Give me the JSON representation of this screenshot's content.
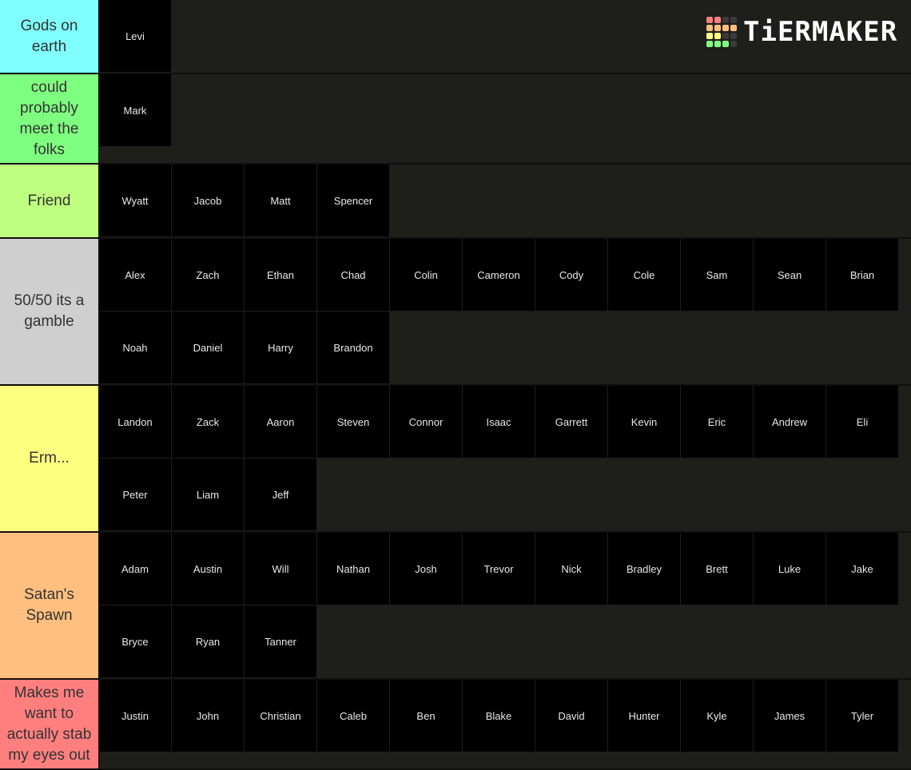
{
  "logo": {
    "text": "TiERMAKER",
    "grid_colors": [
      "#ff7f7f",
      "#ff7f7f",
      "#3a3a3a",
      "#3a3a3a",
      "#ffbf7f",
      "#ffbf7f",
      "#ffbf7f",
      "#ffbf7f",
      "#ffff7f",
      "#ffff7f",
      "#3a3a3a",
      "#3a3a3a",
      "#7fff7f",
      "#7fff7f",
      "#7fff7f",
      "#3a3a3a"
    ]
  },
  "tiers": [
    {
      "label": "Gods on earth",
      "color": "#7fffff",
      "items": [
        "Levi"
      ]
    },
    {
      "label": "could probably meet the folks",
      "color": "#7fff7f",
      "items": [
        "Mark"
      ]
    },
    {
      "label": "Friend",
      "color": "#bfff7f",
      "items": [
        "Wyatt",
        "Jacob",
        "Matt",
        "Spencer"
      ]
    },
    {
      "label": "50/50 its a gamble",
      "color": "#cfcfcf",
      "items": [
        "Alex",
        "Zach",
        "Ethan",
        "Chad",
        "Colin",
        "Cameron",
        "Cody",
        "Cole",
        "Sam",
        "Sean",
        "Brian",
        "Noah",
        "Daniel",
        "Harry",
        "Brandon"
      ]
    },
    {
      "label": "Erm...",
      "color": "#ffff7f",
      "items": [
        "Landon",
        "Zack",
        "Aaron",
        "Steven",
        "Connor",
        "Isaac",
        "Garrett",
        "Kevin",
        "Eric",
        "Andrew",
        "Eli",
        "Peter",
        "Liam",
        "Jeff"
      ]
    },
    {
      "label": "Satan's Spawn",
      "color": "#ffbf7f",
      "items": [
        "Adam",
        "Austin",
        "Will",
        "Nathan",
        "Josh",
        "Trevor",
        "Nick",
        "Bradley",
        "Brett",
        "Luke",
        "Jake",
        "Bryce",
        "Ryan",
        "Tanner"
      ]
    },
    {
      "label": "Makes me want to actually stab my eyes out",
      "color": "#ff7f7f",
      "items": [
        "Justin",
        "John",
        "Christian",
        "Caleb",
        "Ben",
        "Blake",
        "David",
        "Hunter",
        "Kyle",
        "James",
        "Tyler"
      ]
    }
  ]
}
